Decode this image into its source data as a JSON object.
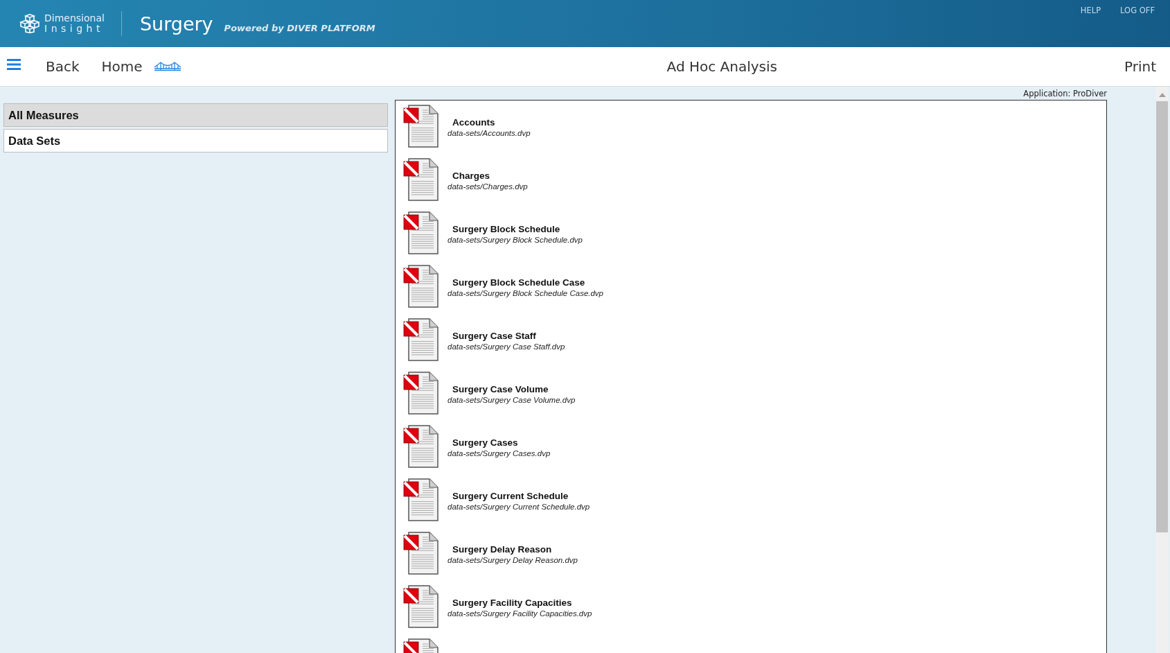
{
  "header": {
    "logo_line1": "Dimensional",
    "logo_line2": "Insight",
    "app_title": "Surgery",
    "tagline": "Powered by DIVER PLATFORM",
    "links": [
      "HELP",
      "LOG OFF"
    ]
  },
  "nav": {
    "back": "Back",
    "home": "Home",
    "title": "Ad Hoc Analysis",
    "print": "Print"
  },
  "sidebar": {
    "items": [
      {
        "label": "All Measures",
        "selected": true
      },
      {
        "label": "Data Sets",
        "selected": false
      }
    ]
  },
  "application_label": "Application: ProDiver",
  "data_sets": [
    {
      "name": "Accounts",
      "path": "data-sets/Accounts.dvp"
    },
    {
      "name": "Charges",
      "path": "data-sets/Charges.dvp"
    },
    {
      "name": "Surgery Block Schedule",
      "path": "data-sets/Surgery Block Schedule.dvp"
    },
    {
      "name": "Surgery Block Schedule Case",
      "path": "data-sets/Surgery Block Schedule Case.dvp"
    },
    {
      "name": "Surgery Case Staff",
      "path": "data-sets/Surgery Case Staff.dvp"
    },
    {
      "name": "Surgery Case Volume",
      "path": "data-sets/Surgery Case Volume.dvp"
    },
    {
      "name": "Surgery Cases",
      "path": "data-sets/Surgery Cases.dvp"
    },
    {
      "name": "Surgery Current Schedule",
      "path": "data-sets/Surgery Current Schedule.dvp"
    },
    {
      "name": "Surgery Delay Reason",
      "path": "data-sets/Surgery Delay Reason.dvp"
    },
    {
      "name": "Surgery Facility Capacities",
      "path": "data-sets/Surgery Facility Capacities.dvp"
    }
  ]
}
